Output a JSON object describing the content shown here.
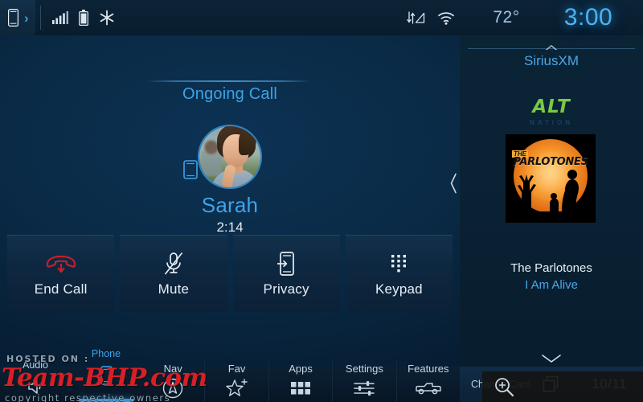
{
  "statusbar": {
    "phone_icon": "phone-icon",
    "chevron": "›",
    "signal_icon": "signal-bars-icon",
    "battery_icon": "battery-icon",
    "bluetooth_icon": "snowflake-icon",
    "nav_icon": "navigation-data-icon",
    "wifi_icon": "wifi-icon",
    "temperature": "72°",
    "clock": "3:00"
  },
  "call": {
    "title": "Ongoing Call",
    "caller_name": "Sarah",
    "duration": "2:14",
    "device_badge_icon": "mobile-phone-icon",
    "avatar_alt": "caller-photo",
    "actions": [
      {
        "label": "End Call",
        "icon": "end-call-icon"
      },
      {
        "label": "Mute",
        "icon": "microphone-muted-icon"
      },
      {
        "label": "Privacy",
        "icon": "privacy-phone-icon"
      },
      {
        "label": "Keypad",
        "icon": "keypad-dots-icon"
      }
    ],
    "prev_page_icon": "chevron-left-icon"
  },
  "media": {
    "source": "SiriusXM",
    "expand_icon": "chevron-up-icon",
    "station_logo": "ALT",
    "station_logo_sub": "NATION",
    "album_art_title": "PARLOTONES",
    "album_art_the": "THE",
    "artist": "The Parlotones",
    "track": "I Am Alive",
    "change_card_label": "Change Card",
    "cards_icon": "stacked-cards-icon",
    "card_count": "10/11",
    "collapse_icon": "chevron-down-icon"
  },
  "tabs": [
    {
      "label": "Audio",
      "icon": "audio-icon",
      "active": false
    },
    {
      "label": "Phone",
      "icon": "phone-tab-icon",
      "active": true
    }
  ],
  "navbar": [
    {
      "label": "Nav",
      "icon": "compass-icon"
    },
    {
      "label": "Fav",
      "icon": "star-plus-icon"
    },
    {
      "label": "Apps",
      "icon": "apps-grid-icon"
    },
    {
      "label": "Settings",
      "icon": "sliders-icon"
    },
    {
      "label": "Features",
      "icon": "truck-icon"
    }
  ],
  "watermark": {
    "hosted": "HOSTED ON :",
    "site": "Team-BHP.com",
    "copyright": "copyright respective owners",
    "zoom_icon": "zoom-in-icon"
  },
  "colors": {
    "accent_blue": "#3ea3e8",
    "clock_blue": "#4ab3f4",
    "end_call_red": "#c0212c",
    "station_green": "#7ac943",
    "panel_navy": "#0a2b47"
  }
}
